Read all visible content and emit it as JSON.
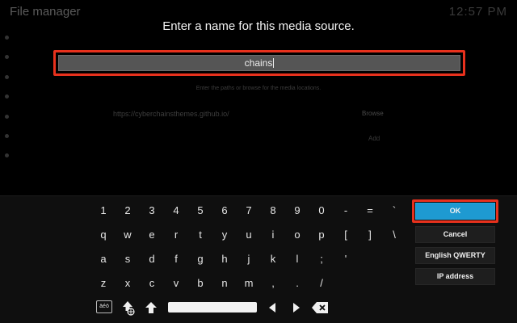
{
  "background": {
    "title": "File manager",
    "clock": "12:57 PM",
    "hint": "Enter the paths or browse for the media locations.",
    "url": "https://cyberchainsthemes.github.io/",
    "browse": "Browse",
    "add": "Add"
  },
  "dialog": {
    "heading": "Enter a name for this media source.",
    "input_value": "chains"
  },
  "keyboard": {
    "row1": [
      "1",
      "2",
      "3",
      "4",
      "5",
      "6",
      "7",
      "8",
      "9",
      "0",
      "-",
      "=",
      "`"
    ],
    "row2": [
      "q",
      "w",
      "e",
      "r",
      "t",
      "y",
      "u",
      "i",
      "o",
      "p",
      "[",
      "]",
      "\\"
    ],
    "row3": [
      "a",
      "s",
      "d",
      "f",
      "g",
      "h",
      "j",
      "k",
      "l",
      ";",
      "'"
    ],
    "row4": [
      "z",
      "x",
      "c",
      "v",
      "b",
      "n",
      "m",
      ",",
      ".",
      "/"
    ],
    "layout_key": "äéö",
    "icons": {
      "symbols": "globe-shift-icon",
      "shift": "arrow-up-icon",
      "left": "arrow-left-icon",
      "right": "arrow-right-icon",
      "backspace": "backspace-icon"
    }
  },
  "buttons": {
    "ok": "OK",
    "cancel": "Cancel",
    "layout": "English QWERTY",
    "ip": "IP address"
  },
  "colors": {
    "highlight": "#e8311d",
    "ok_focus": "#1e9ad1"
  }
}
